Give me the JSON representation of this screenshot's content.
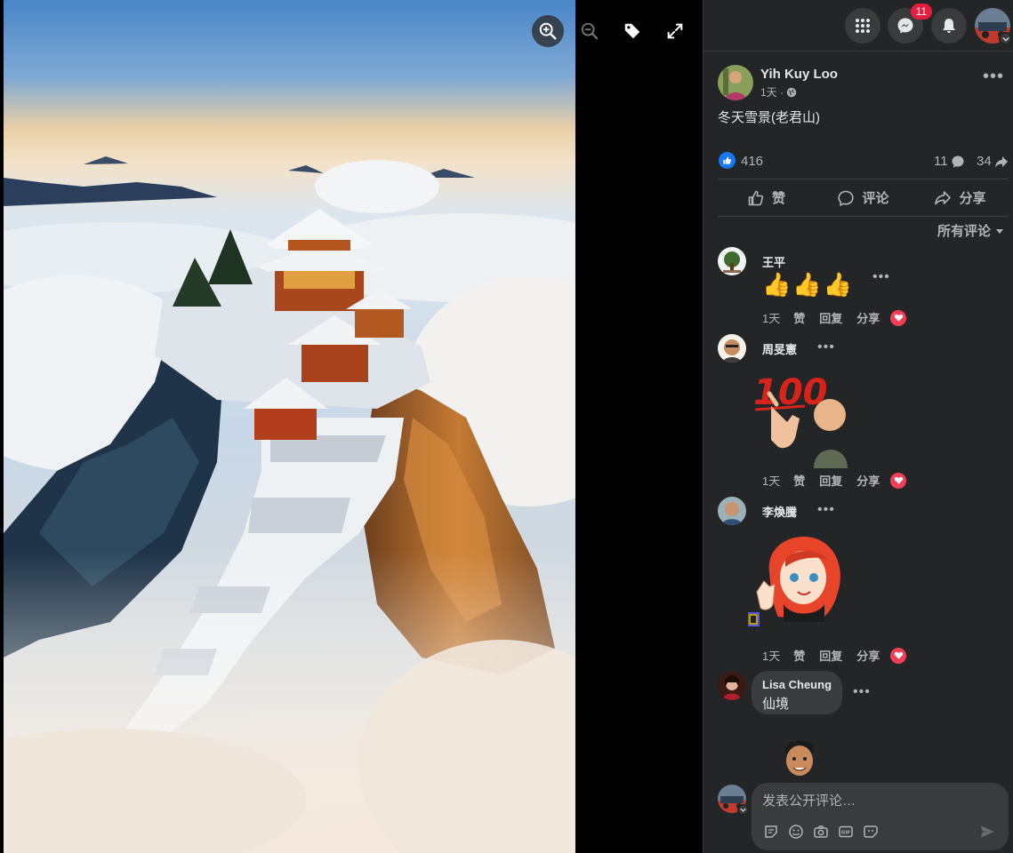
{
  "viewer": {
    "tools": [
      "zoom-in-icon",
      "zoom-out-icon",
      "tag-icon",
      "fullscreen-icon"
    ]
  },
  "topbar": {
    "icons": [
      "menu-grid-icon",
      "messenger-icon",
      "bell-icon"
    ],
    "messenger_badge": "11"
  },
  "post": {
    "author": "Yih Kuy Loo",
    "time": "1天 ·",
    "privacy_icon": "globe-icon",
    "text": "冬天雪景(老君山)",
    "like_count": "416",
    "comment_count": "11",
    "share_count": "34"
  },
  "actions": {
    "like": "赞",
    "comment": "评论",
    "share": "分享"
  },
  "sort_label": "所有评论",
  "comment_meta": {
    "time": "1天",
    "like": "赞",
    "reply": "回复",
    "share": "分享"
  },
  "comments": [
    {
      "name": "王平",
      "content": "👍👍👍"
    },
    {
      "name": "周旻憲",
      "sticker": "100 thumbs-up sticker"
    },
    {
      "name": "李煥騰",
      "sticker": "red-haired girl thumbs-up sticker"
    },
    {
      "name": "Lisa Cheung",
      "text": "仙境"
    },
    {
      "sticker": "man avatar sticker"
    }
  ],
  "composer": {
    "placeholder": "发表公开评论…",
    "tools": [
      "sticker-icon",
      "emoji-icon",
      "camera-icon",
      "gif-icon",
      "avatar-sticker-icon",
      "send-icon"
    ]
  },
  "colors": {
    "panel_bg": "#242526",
    "bubble_bg": "#3a3b3c",
    "text_primary": "#e4e6eb",
    "text_secondary": "#b0b3b8",
    "like_blue": "#1877f2",
    "heart_red": "#f33e58",
    "badge_red": "#e41e3f"
  }
}
